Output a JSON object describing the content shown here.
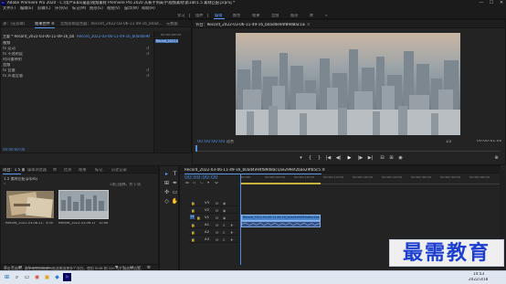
{
  "titlebar": {
    "app_icon": "Pr",
    "title": "Adobe Premiere Pro 2020 - C:\\用户\\Eba\\桌面\\视频素材 Premiere Pro 2020 从新手到高手\\视频素材\\第1章\\1.5 素材匹配.prproj *",
    "minimize": "—",
    "maximize": "☐",
    "close": "✕"
  },
  "menu": [
    "文件(F)",
    "编辑(E)",
    "剪辑(C)",
    "序列(S)",
    "标记(M)",
    "图形(G)",
    "视图(V)",
    "窗口(W)",
    "帮助(H)"
  ],
  "workspaces": {
    "items": [
      "学习",
      "组件",
      "编辑",
      "颜色",
      "效果",
      "音频",
      "图形",
      "库"
    ],
    "active_index": 2,
    "more": "»"
  },
  "effect_controls": {
    "tabs": [
      "源：(无剪辑)",
      "效果控件 ≡",
      "音频剪辑混合器：Record_2022-03-06-11-49-16_b0ad...",
      "元数据"
    ],
    "active_tab": 1,
    "master_label": "主要 * Record_2022-03-06-11-49-16_b0ad4e94f...",
    "sequence_label": "Record_2022-03-06-11-49-16_b0ad4e94f89d8ac1ae299ef2bae29fb5c5...",
    "mini_timecode": "00:00:05:00",
    "clip_bar_label": "Record_2022-03-06-11-4...",
    "sections": [
      {
        "label": "视频",
        "type": "header"
      },
      {
        "label": "fx  运动",
        "type": "effect"
      },
      {
        "label": "fx  不透明度",
        "type": "effect"
      },
      {
        "label": "    时间重映射",
        "type": "effect"
      },
      {
        "label": "音频",
        "type": "header"
      },
      {
        "label": "fx  音量",
        "type": "effect"
      },
      {
        "label": "fx  声道音量",
        "type": "effect"
      }
    ],
    "bottom_timecode": "00:00:00:00"
  },
  "program_monitor": {
    "tab": "节目：Record_2022-03-06-11-49-16_b0ad4e94f89d8ac1ae299ef2bae29fb5c5",
    "menu_icon": "≡",
    "timecode_left": "00:00:00:00",
    "fit": "适合",
    "fraction": "1/2",
    "timecode_right": "00:00:01:00",
    "transport": [
      "▾",
      "{",
      "}",
      "|◀",
      "◀|",
      "▶",
      "|▶",
      "▶|",
      "⊟",
      "⊞",
      "◉",
      "⊕"
    ]
  },
  "project": {
    "tabs": [
      "项目：1.5 素材匹配",
      "媒体浏览器",
      "库",
      "信息",
      "效果",
      "标记",
      "历史记录"
    ],
    "active_tab": 0,
    "file": "1.5 素材匹配.prproj",
    "count": "1项已选择，共 2 项",
    "items": [
      {
        "name": "Record_2022-03-06-11-49-16...",
        "duration": "5:00"
      },
      {
        "name": "Record_2022-03-06-11-49-16...",
        "duration": "10:06"
      }
    ],
    "bottom_icons": [
      "✎",
      "≡",
      "▦",
      "○",
      "◆",
      "▤",
      "⌕",
      "▭",
      "🗑"
    ]
  },
  "tools": [
    "▸",
    "⊞",
    "✣",
    "◇",
    "✒",
    "▭",
    "✋",
    "T"
  ],
  "timeline": {
    "tab": "Record_2022-03-06-11-49-16_b0ad4e94f89d8ac1ae299ef2bae29fb5c5 ≡",
    "timecode": "00:00:00:00",
    "ruler_ticks": [
      "00:00",
      "00:00:05:00",
      "00:00:10:00",
      "00:00:15:00",
      "00:00:20:00",
      "00:00:25:00",
      "00:00:30:00",
      "00:00:35:00",
      "00:00:40:00"
    ],
    "tracks": [
      {
        "name": "V3",
        "kind": "video"
      },
      {
        "name": "V2",
        "kind": "video"
      },
      {
        "name": "V1",
        "kind": "video"
      },
      {
        "name": "A1",
        "kind": "audio"
      },
      {
        "name": "A2",
        "kind": "audio"
      },
      {
        "name": "A3",
        "kind": "audio"
      }
    ],
    "track_toggle": "V1",
    "clip_video_label": "Record_2022-03-06-11-49-16_b0ad4e94f89d8ac1ae299ef2bae29fb5c5[V]"
  },
  "status_bar": "单击可选择，或单击空白处进行框选来选择多个项目。使用 Shift 和 Ctrl 可扩展选择范围。",
  "taskbar": {
    "icons": [
      "⊞",
      "⌕",
      "▭",
      "◉",
      "▣",
      "◆",
      "Pr"
    ],
    "time": "14:53",
    "date": "2022/3/18"
  },
  "watermark": "最需教育",
  "colors": {
    "accent": "#5b9bf0",
    "timecode": "#4f8de0",
    "clip_video": "#4a87cf",
    "clip_audio": "#2f4f86",
    "work_area": "#c7b33a",
    "watermark": "#1c3fd0"
  }
}
